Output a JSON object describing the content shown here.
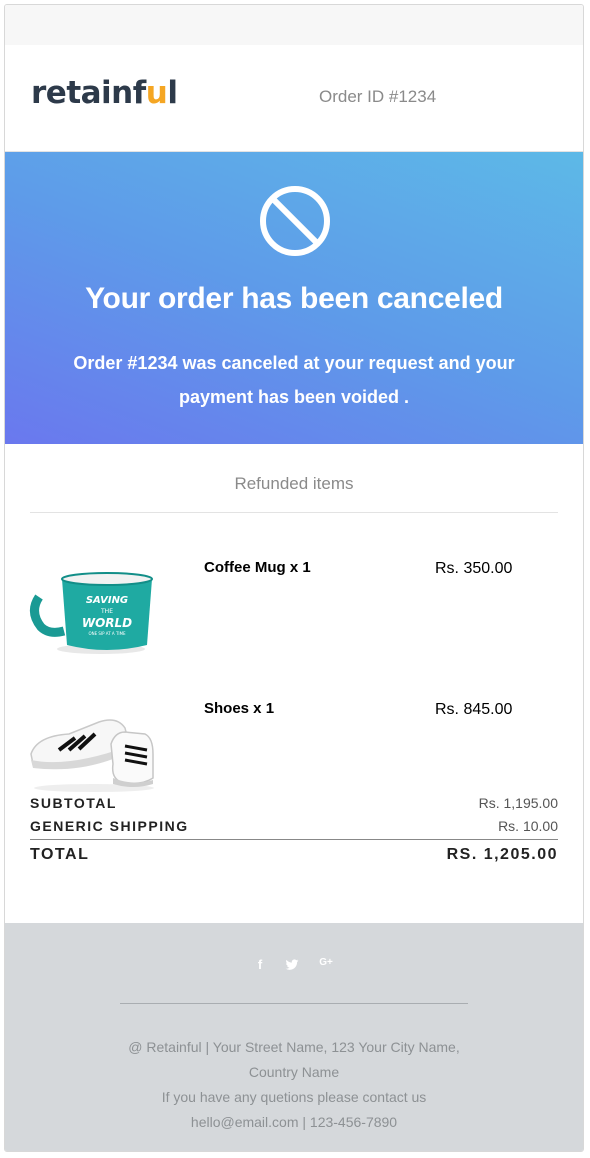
{
  "header": {
    "logo_prefix": "retainf",
    "logo_highlight": "u",
    "logo_suffix": "l",
    "order_id": "Order ID #1234"
  },
  "hero": {
    "title": "Your order has been canceled",
    "message": "Order #1234 was canceled at your request and your payment has been voided ."
  },
  "refunded_heading": "Refunded items",
  "items": [
    {
      "name": "Coffee Mug x 1",
      "price": "Rs. 350.00",
      "image": "coffee-mug-image",
      "mug_text_1": "SAVING",
      "mug_text_2": "THE",
      "mug_text_3": "WORLD",
      "mug_text_4": "ONE SIP AT A TIME"
    },
    {
      "name": "Shoes x 1",
      "price": "Rs. 845.00",
      "image": "sneakers-image"
    }
  ],
  "totals": {
    "subtotal_label": "SUBTOTAL",
    "subtotal_value": "Rs. 1,195.00",
    "shipping_label": "GENERIC SHIPPING",
    "shipping_value": "Rs. 10.00",
    "total_label": "TOTAL",
    "total_value": "RS. 1,205.00"
  },
  "footer": {
    "social": [
      "facebook-icon",
      "twitter-icon",
      "google-plus-icon"
    ],
    "facebook_glyph": "f",
    "google_glyph": "G+",
    "address_line1": "@ Retainful | Your Street Name, 123 Your City Name,",
    "address_line2": "Country Name",
    "contact_line": "If you have any quetions please contact us",
    "email_phone": "hello@email.com | 123-456-7890"
  },
  "colors": {
    "hero_top": "#5db9e7",
    "hero_bottom": "#6a78ee",
    "logo_text": "#2d3a4a",
    "logo_accent": "#f5a623",
    "footer_bg": "#d5d8db"
  }
}
